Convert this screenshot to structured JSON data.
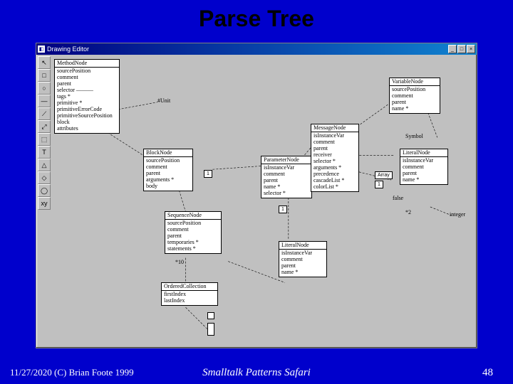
{
  "slide": {
    "title": "Parse Tree",
    "footer": {
      "left": "11/27/2020 (C) Brian Foote 1999",
      "center": "Smalltalk Patterns Safari",
      "right": "48"
    }
  },
  "window": {
    "title": "Drawing Editor",
    "sys_buttons": {
      "min": "_",
      "max": "□",
      "close": "×"
    },
    "tools": [
      "↖",
      "□",
      "○",
      "—",
      "⟋",
      "⤢",
      "⬚",
      "T",
      "△",
      "◇",
      "◯",
      "xy"
    ]
  },
  "nodes": {
    "method": {
      "title": "MethodNode",
      "rows": [
        "sourcePosition",
        "comment",
        "parent",
        "selector ———",
        "tags *",
        "primitive *",
        "primitiveErrorCode",
        "primitiveSourcePosition",
        "block",
        "attributes"
      ]
    },
    "block": {
      "title": "BlockNode",
      "rows": [
        "sourcePosition",
        "comment",
        "parent",
        "arguments *",
        "body"
      ]
    },
    "sequence": {
      "title": "SequenceNode",
      "rows": [
        "sourcePosition",
        "comment",
        "parent",
        "temporaries *",
        "statements *"
      ]
    },
    "ordered": {
      "title": "OrderedCollection",
      "rows": [
        "firstIndex",
        "lastIndex"
      ]
    },
    "parameter": {
      "title": "ParameterNode",
      "rows": [
        "isInstanceVar",
        "comment",
        "parent",
        "name *",
        "selector *"
      ]
    },
    "message": {
      "title": "MessageNode",
      "rows": [
        "isInstanceVar",
        "comment",
        "parent",
        "receiver",
        "selector *",
        "arguments *",
        "precedence",
        "cascadeList *",
        "colorList *"
      ]
    },
    "variable": {
      "title": "VariableNode",
      "rows": [
        "sourcePosition",
        "comment",
        "parent",
        "name *"
      ]
    },
    "literal1": {
      "title": "LiteralNode",
      "rows": [
        "isInstanceVar",
        "comment",
        "parent",
        "name *"
      ]
    },
    "literal2": {
      "title": "LiteralNode",
      "rows": [
        "isInstanceVar",
        "comment",
        "parent",
        "name *"
      ]
    }
  },
  "labels": {
    "sunit": "#Unit",
    "one1": "1",
    "ten": "*10",
    "one2": "1",
    "array": "Array",
    "one3": "1",
    "symbol": "Symbol",
    "false": "false",
    "integer": "integer",
    "two": "*2"
  }
}
